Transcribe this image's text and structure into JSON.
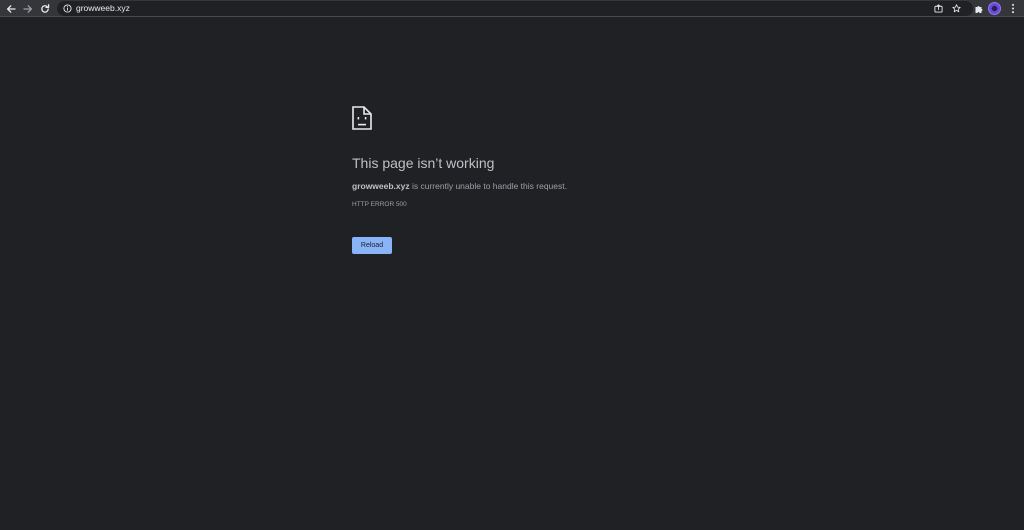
{
  "browser": {
    "url": "growweeb.xyz",
    "icons": {
      "back": "arrow-left-icon",
      "forward": "arrow-right-icon",
      "reload": "reload-icon",
      "site_info": "info-icon",
      "share": "share-icon",
      "bookmark": "star-icon",
      "extensions": "puzzle-icon",
      "menu": "kebab-menu-icon"
    }
  },
  "error_page": {
    "icon": "sad-page-icon",
    "headline": "This page isn’t working",
    "host": "growweeb.xyz",
    "summary_rest": " is currently unable to handle this request.",
    "error_code": "HTTP ERROR 500",
    "reload_label": "Reload"
  },
  "colors": {
    "background": "#202124",
    "toolbar": "#35363a",
    "button": "#8ab4f8",
    "headline_text": "#bdc1c6",
    "body_text": "#9aa0a6"
  }
}
